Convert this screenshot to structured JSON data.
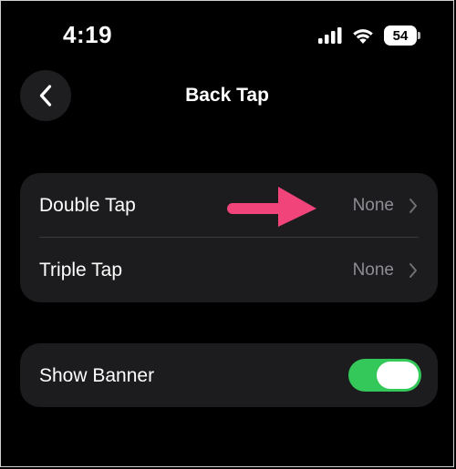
{
  "status_bar": {
    "time": "4:19",
    "battery_level": "54",
    "icons": [
      "cellular-signal-icon",
      "wifi-icon",
      "battery-icon"
    ]
  },
  "nav": {
    "title": "Back Tap",
    "back_icon": "chevron-left-icon"
  },
  "tap_settings": [
    {
      "label": "Double Tap",
      "value": "None"
    },
    {
      "label": "Triple Tap",
      "value": "None"
    }
  ],
  "banner": {
    "label": "Show Banner",
    "enabled": true
  },
  "colors": {
    "background": "#000000",
    "group_background": "#1c1c1e",
    "toggle_on": "#34c759",
    "secondary_text": "#8d8d93",
    "annotation_arrow": "#f0447a"
  }
}
